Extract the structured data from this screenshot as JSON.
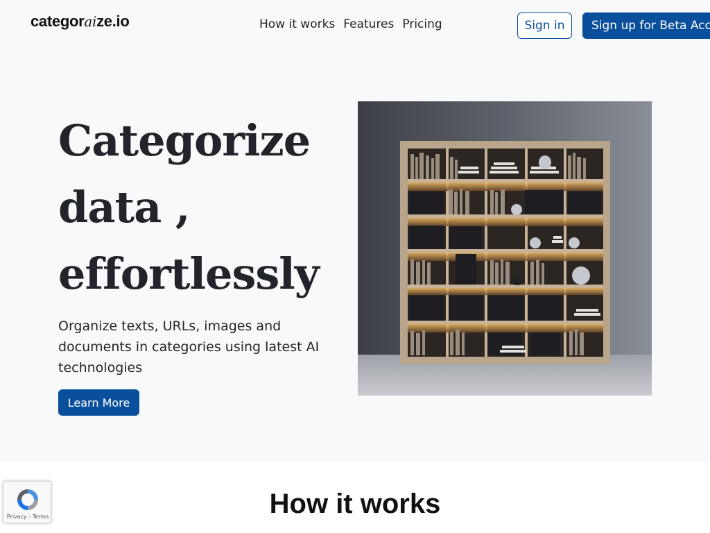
{
  "navbar": {
    "logo_prefix": "categor",
    "logo_ai": "ai",
    "logo_suffix": "ze.io",
    "links": [
      "How it works",
      "Features",
      "Pricing"
    ],
    "sign_in": "Sign in",
    "sign_up": "Sign up for Beta Access"
  },
  "hero": {
    "title_line1": "Categorize",
    "title_line2": "data ,",
    "title_line3": "effortlessly",
    "subtitle": "Organize texts, URLs, images and documents in categories using latest AI technologies",
    "cta": "Learn More"
  },
  "how_it_works": {
    "title": "How it works"
  },
  "recaptcha": {
    "privacy": "Privacy",
    "separator": " - ",
    "terms": "Terms"
  },
  "colors": {
    "primary": "#0a4f9c",
    "background": "#f8f9fa",
    "text": "#212529"
  }
}
